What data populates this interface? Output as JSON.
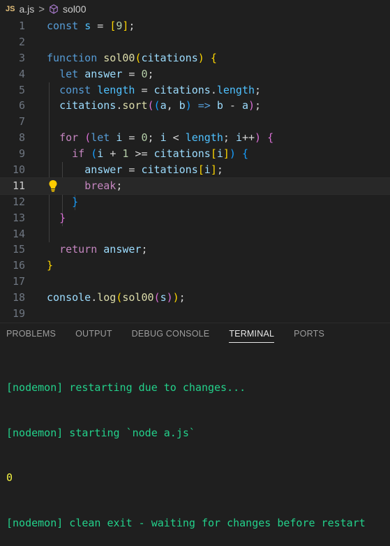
{
  "breadcrumb": {
    "file_badge": "JS",
    "file_name": "a.js",
    "separator": ">",
    "symbol_name": "sol00"
  },
  "editor": {
    "lines": [
      {
        "n": "1"
      },
      {
        "n": "2"
      },
      {
        "n": "3"
      },
      {
        "n": "4"
      },
      {
        "n": "5"
      },
      {
        "n": "6"
      },
      {
        "n": "7"
      },
      {
        "n": "8"
      },
      {
        "n": "9"
      },
      {
        "n": "10"
      },
      {
        "n": "11"
      },
      {
        "n": "12"
      },
      {
        "n": "13"
      },
      {
        "n": "14"
      },
      {
        "n": "15"
      },
      {
        "n": "16"
      },
      {
        "n": "17"
      },
      {
        "n": "18"
      },
      {
        "n": "19"
      }
    ],
    "active_line": "11"
  },
  "panel": {
    "tabs": [
      "PROBLEMS",
      "OUTPUT",
      "DEBUG CONSOLE",
      "TERMINAL",
      "PORTS"
    ],
    "active_tab": "TERMINAL"
  },
  "terminal": {
    "lines": [
      "[nodemon] restarting due to changes...",
      "[nodemon] starting `node a.js`",
      "0",
      "[nodemon] clean exit - waiting for changes before restart"
    ]
  },
  "colors": {
    "background": "#1f1f1f",
    "terminal_green": "#23d18b",
    "terminal_yellow": "#f5f543",
    "bulb": "#ffcc00"
  }
}
